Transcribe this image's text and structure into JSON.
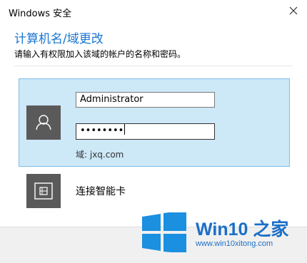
{
  "window": {
    "title": "Windows 安全"
  },
  "dialog": {
    "heading": "计算机名/域更改",
    "description": "请输入有权限加入该域的帐户的名称和密码。"
  },
  "credential": {
    "username": "Administrator",
    "password_mask": "••••••••",
    "domain_label": "域: jxq.com",
    "avatar_icon": "user-icon"
  },
  "smartcard": {
    "label": "连接智能卡",
    "icon": "smart-card-icon"
  },
  "watermark": {
    "title": "Win10 之家",
    "url": "www.win10xitong.com"
  },
  "colors": {
    "accent": "#1a75d0",
    "tile_bg": "#cde8f7",
    "tile_border": "#7fbde6",
    "icon_bg": "#5a5a5a"
  }
}
